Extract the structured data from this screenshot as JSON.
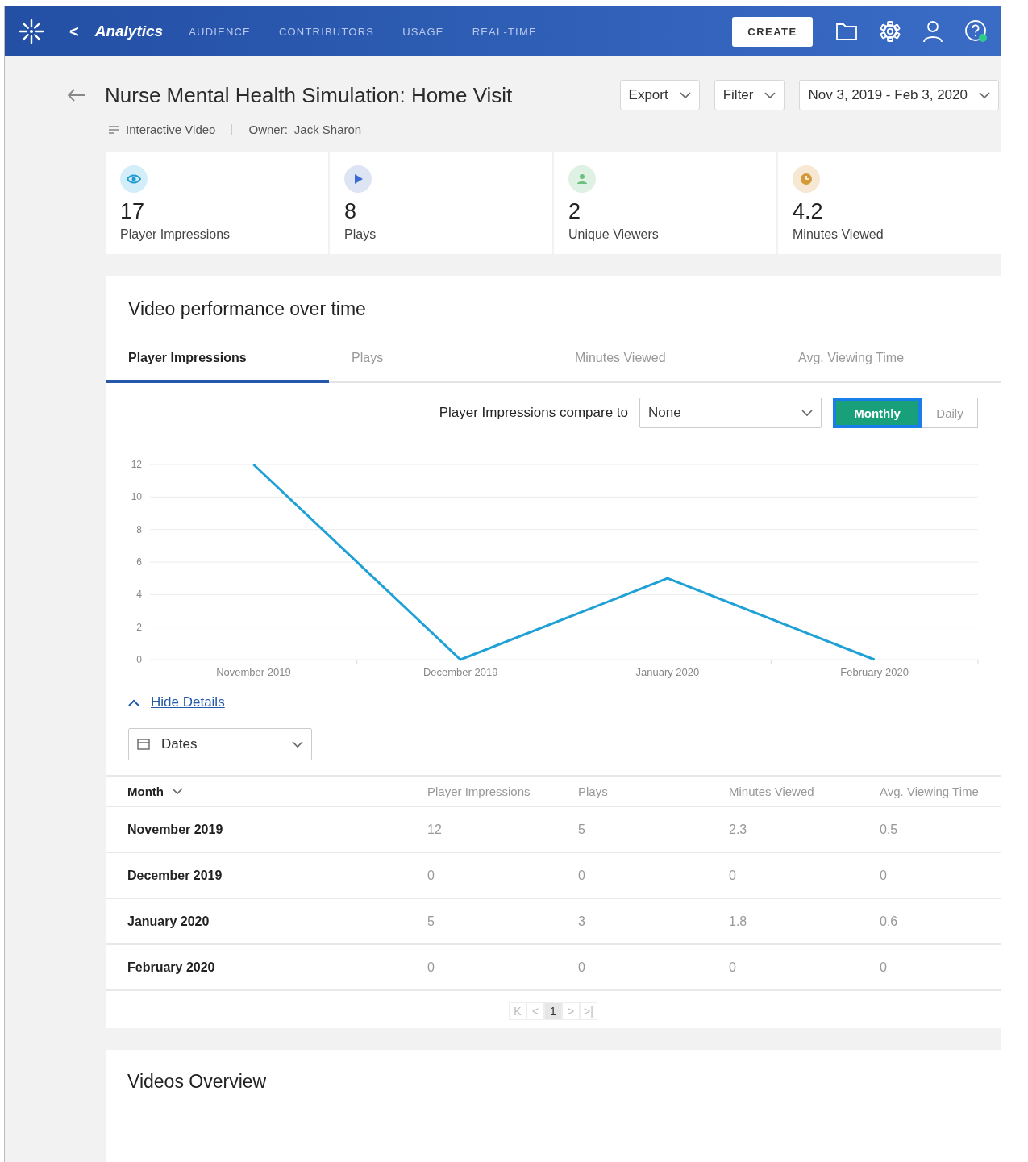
{
  "topbar": {
    "brand": "Analytics",
    "back": "<",
    "nav": [
      {
        "label": "AUDIENCE",
        "selected": false
      },
      {
        "label": "CONTRIBUTORS",
        "selected": false
      },
      {
        "label": "USAGE",
        "selected": false
      },
      {
        "label": "REAL-TIME",
        "selected": false
      }
    ],
    "create": "CREATE"
  },
  "header": {
    "title": "Nurse Mental Health Simulation: Home Visit",
    "type": "Interactive Video",
    "owner_label": "Owner:",
    "owner": "Jack Sharon",
    "export": "Export",
    "filter": "Filter",
    "date_range": "Nov 3, 2019 - Feb 3, 2020"
  },
  "stats": [
    {
      "kind": "eye",
      "value": "17",
      "label": "Player Impressions"
    },
    {
      "kind": "play",
      "value": "8",
      "label": "Plays"
    },
    {
      "kind": "person",
      "value": "2",
      "label": "Unique Viewers"
    },
    {
      "kind": "clock",
      "value": "4.2",
      "label": "Minutes Viewed"
    }
  ],
  "performance": {
    "title": "Video performance over time",
    "tabs": [
      {
        "label": "Player Impressions",
        "selected": true
      },
      {
        "label": "Plays",
        "selected": false
      },
      {
        "label": "Minutes Viewed",
        "selected": false
      },
      {
        "label": "Avg. Viewing Time",
        "selected": false
      }
    ],
    "compare_label": "Player Impressions compare to",
    "compare_value": "None",
    "granularity": [
      {
        "label": "Monthly",
        "selected": true
      },
      {
        "label": "Daily",
        "selected": false
      }
    ],
    "chart_data": {
      "type": "line",
      "categories": [
        "November 2019",
        "December 2019",
        "January 2020",
        "February 2020"
      ],
      "series": [
        {
          "color": "#1fa0d6",
          "values": [
            12,
            0,
            5,
            0
          ]
        }
      ],
      "grid": true,
      "ylim": [
        0,
        12
      ],
      "yticks": [
        0,
        2,
        4,
        6,
        8,
        10,
        12
      ]
    },
    "hide_details": "Hide Details",
    "dates_select": "Dates",
    "table": {
      "columns": [
        "Month",
        "Player Impressions",
        "Plays",
        "Minutes Viewed",
        "Avg. Viewing Time"
      ],
      "rows": [
        [
          "November 2019",
          "12",
          "5",
          "2.3",
          "0.5"
        ],
        [
          "December 2019",
          "0",
          "0",
          "0",
          "0"
        ],
        [
          "January 2020",
          "5",
          "3",
          "1.8",
          "0.6"
        ],
        [
          "February 2020",
          "0",
          "0",
          "0",
          "0"
        ]
      ]
    },
    "pagination": {
      "first": "K",
      "prev": "<",
      "page": "1",
      "next": ">",
      "last": ">|"
    }
  },
  "overview": {
    "title": "Videos Overview"
  }
}
